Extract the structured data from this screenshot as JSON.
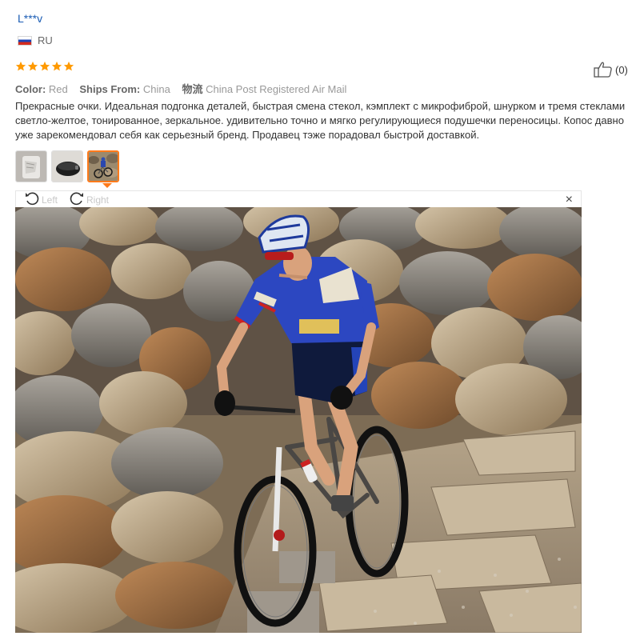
{
  "review": {
    "reviewer": "L***v",
    "country_code": "RU",
    "rating": 5,
    "helpful_count": "(0)",
    "meta": {
      "color_label": "Color:",
      "color_value": "Red",
      "ships_from_label": "Ships From:",
      "ships_from_value": "China",
      "logistics_label": "物流",
      "logistics_value": "China Post Registered Air Mail"
    },
    "text": "Прекрасные очки. Идеальная подгонка деталей, быстрая смена стекол, кэмплект с микрофиброй, шнурком и тремя стеклами светло-желтое, тонированное, зеркальное. удивительно точно и мягко регулирующиеся подушечки переносицы. Копос давно уже зарекомендовал себя как серьезный бренд. Продавец тэже порадовал быстрой доставкой."
  },
  "thumbnails": [
    {
      "name": "photo-1",
      "active": false
    },
    {
      "name": "photo-2",
      "active": false
    },
    {
      "name": "photo-3",
      "active": true
    }
  ],
  "viewer": {
    "rotate_left_label": "Left",
    "rotate_right_label": "Right",
    "close_label": "×"
  },
  "icons": [
    "flag-ru-icon",
    "star-icon",
    "thumbs-up-icon",
    "rotate-left-icon",
    "rotate-right-icon",
    "close-icon"
  ],
  "colors": {
    "star": "#ff9a00",
    "reviewer_link": "#1a5cb4",
    "active_thumb": "#ff7a1a",
    "meta_gray": "#999999"
  }
}
